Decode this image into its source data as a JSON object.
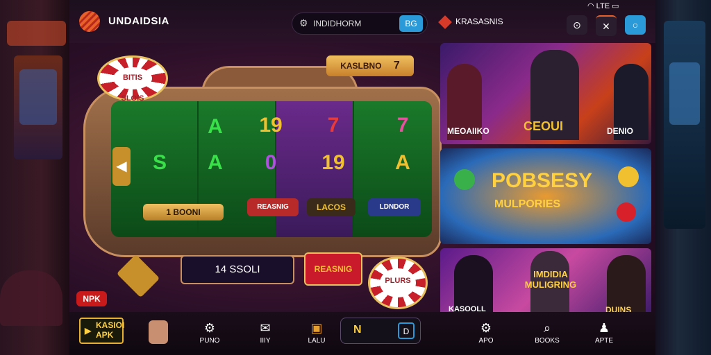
{
  "app": {
    "brand": "UNDAIDSIA"
  },
  "search": {
    "text": "INDIDHORM",
    "button": "BG"
  },
  "location": {
    "label": "KRASASNIS"
  },
  "topright": {
    "status": "LTE"
  },
  "slot": {
    "badge": "KASLBNO",
    "badge_num": "7",
    "reels": [
      [
        "A",
        "S",
        "A"
      ],
      [
        "19",
        "0",
        "19"
      ],
      [
        "7",
        "19",
        "A"
      ],
      [
        "7",
        "A",
        ""
      ]
    ],
    "reel_labels": [
      "REASNIG",
      "LACOS",
      "LDNDOR"
    ],
    "bonus_label": "1 BOONI",
    "chip_label": "BITIS SLOIS",
    "bet_label": "14 SSOLI",
    "round_label": "NPK",
    "jackpot_chip": "PLURS"
  },
  "cards": [
    {
      "left": "MEOAIIKO",
      "center": "CEOUI",
      "right": "DENIO"
    },
    {
      "title": "POBSESY",
      "subtitle": "MULPORIES"
    },
    {
      "left": "KASOOLL",
      "center": "IMDIDIA MULIGRING",
      "right": "DUINS"
    }
  ],
  "bottom_nav": {
    "app_tag": "KASIOI APK",
    "items": [
      "PUNO",
      "IIIY",
      "LALU"
    ],
    "center_left": "N",
    "center_right": "D",
    "right_items": [
      "APO",
      "BOOKS",
      "APTE"
    ]
  },
  "colors": {
    "accent": "#2a9ad8",
    "brand": "#e8602a",
    "reel_green": "#0c4a18",
    "reel_purple": "#4a1a6a"
  }
}
